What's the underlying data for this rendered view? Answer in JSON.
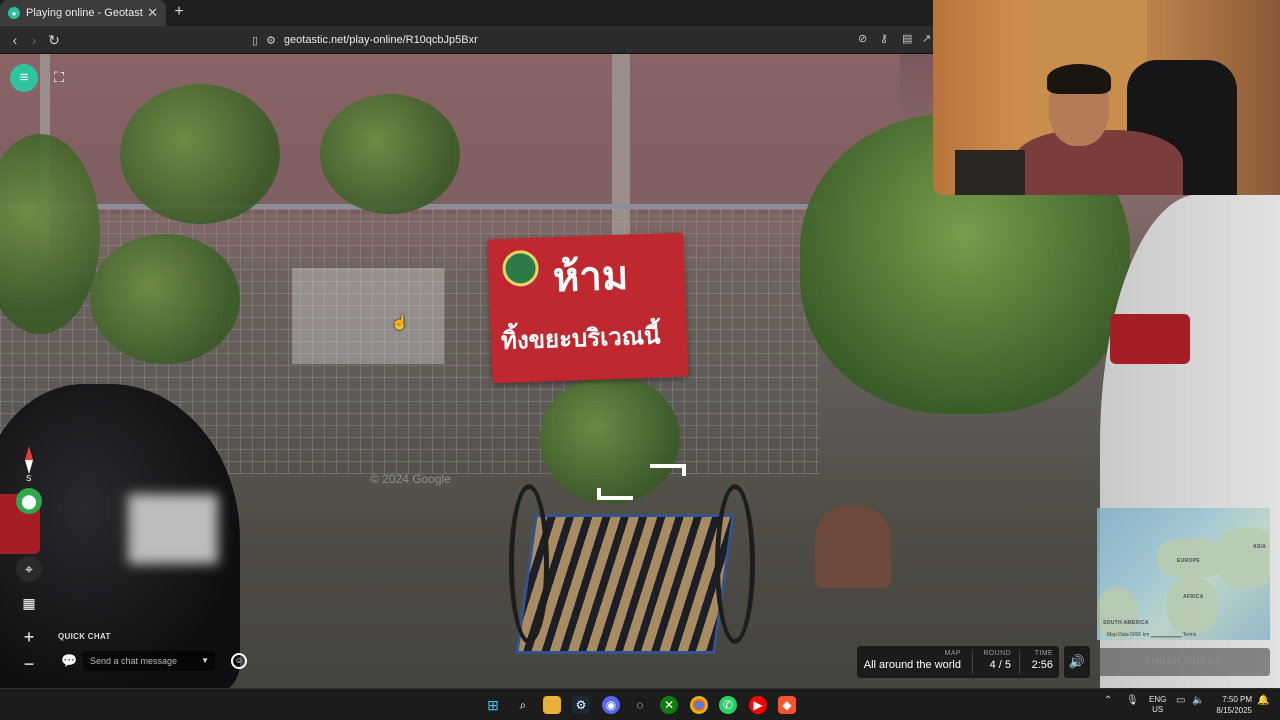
{
  "browser": {
    "tab_title": "Playing online - Geotastic",
    "tab_close": "✕",
    "new_tab": "+",
    "url": "geotastic.net/play-online/R10qcbJp5Bxr"
  },
  "game": {
    "quick_chat_label": "QUICK CHAT",
    "chat_placeholder": "Send a chat message",
    "compass_south": "S",
    "zoom_in": "+",
    "zoom_out": "−",
    "street_view_watermark": "© 2024 Google",
    "map_label": "MAP",
    "map_value": "All around the world",
    "round_label": "ROUND",
    "round_value": "4 / 5",
    "time_label": "TIME",
    "time_value": "2:56",
    "finish_label": "FINISH GUESS",
    "minimap": {
      "labels": [
        "EUROPE",
        "AFRICA",
        "ASIA",
        "SOUTH AMERICA"
      ],
      "footer": "Map Data   5000 km ▁▁▁▁▁▁▁▁   Terms"
    },
    "sign_line1": "ห้าม",
    "sign_line2": "ทิ้งขยะบริเวณนี้"
  },
  "taskbar": {
    "lang_line1": "ENG",
    "lang_line2": "US",
    "time": "7:50 PM",
    "date": "8/15/2025",
    "apps": [
      "windows-start",
      "search",
      "file-explorer",
      "steam",
      "discord",
      "app-6",
      "xbox",
      "chrome",
      "whatsapp",
      "youtube-music",
      "brave"
    ]
  },
  "colors": {
    "accent": "#2ec4a0",
    "sign_red": "#c0282f",
    "chrome_bg": "#1f1f1f"
  }
}
